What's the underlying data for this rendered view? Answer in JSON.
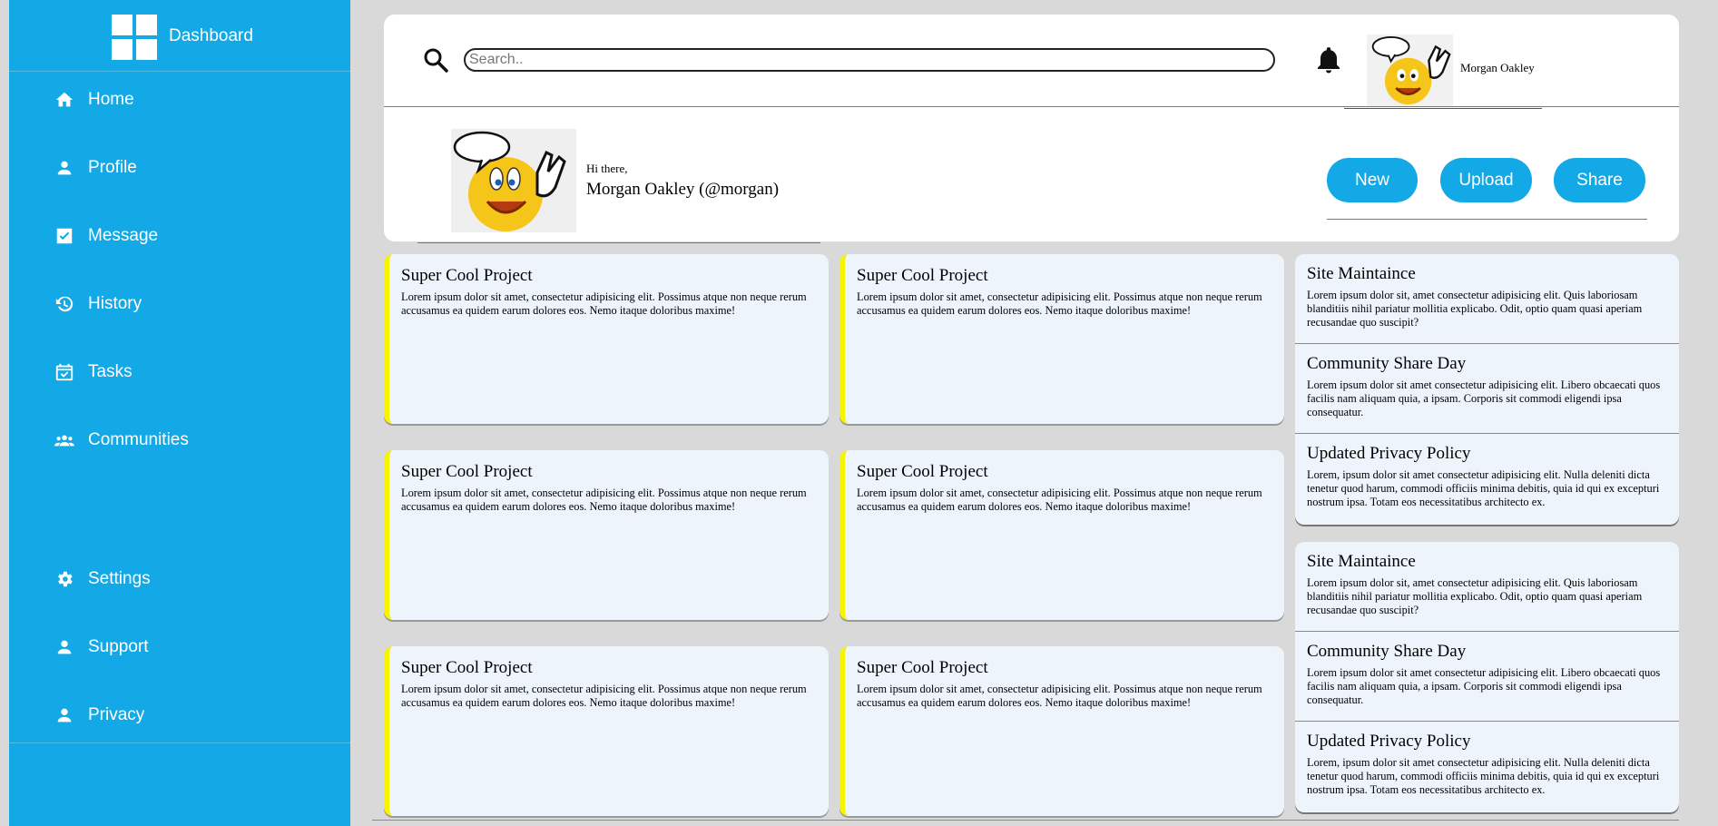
{
  "sidebar": {
    "title": "Dashboard",
    "items": [
      {
        "label": "Home",
        "icon": "home-icon"
      },
      {
        "label": "Profile",
        "icon": "person-icon"
      },
      {
        "label": "Message",
        "icon": "message-check-icon"
      },
      {
        "label": "History",
        "icon": "history-icon"
      },
      {
        "label": "Tasks",
        "icon": "calendar-check-icon"
      },
      {
        "label": "Communities",
        "icon": "group-icon"
      }
    ],
    "bottom_items": [
      {
        "label": "Settings",
        "icon": "gear-icon"
      },
      {
        "label": "Support",
        "icon": "person-icon"
      },
      {
        "label": "Privacy",
        "icon": "person-icon"
      }
    ]
  },
  "header": {
    "search_placeholder": "Search..",
    "username": "Morgan Oakley",
    "greeting": "Hi there,",
    "full_name": "Morgan Oakley (@morgan)",
    "buttons": [
      "New",
      "Upload",
      "Share"
    ]
  },
  "projects": [
    {
      "title": "Super Cool Project",
      "text": "Lorem ipsum dolor sit amet, consectetur adipisicing elit. Possimus atque non neque rerum accusamus ea quidem earum dolores eos. Nemo itaque doloribus maxime!"
    },
    {
      "title": "Super Cool Project",
      "text": "Lorem ipsum dolor sit amet, consectetur adipisicing elit. Possimus atque non neque rerum accusamus ea quidem earum dolores eos. Nemo itaque doloribus maxime!"
    },
    {
      "title": "Super Cool Project",
      "text": "Lorem ipsum dolor sit amet, consectetur adipisicing elit. Possimus atque non neque rerum accusamus ea quidem earum dolores eos. Nemo itaque doloribus maxime!"
    },
    {
      "title": "Super Cool Project",
      "text": "Lorem ipsum dolor sit amet, consectetur adipisicing elit. Possimus atque non neque rerum accusamus ea quidem earum dolores eos. Nemo itaque doloribus maxime!"
    },
    {
      "title": "Super Cool Project",
      "text": "Lorem ipsum dolor sit amet, consectetur adipisicing elit. Possimus atque non neque rerum accusamus ea quidem earum dolores eos. Nemo itaque doloribus maxime!"
    },
    {
      "title": "Super Cool Project",
      "text": "Lorem ipsum dolor sit amet, consectetur adipisicing elit. Possimus atque non neque rerum accusamus ea quidem earum dolores eos. Nemo itaque doloribus maxime!"
    }
  ],
  "announcements": [
    {
      "title": "Site Maintaince",
      "text": "Lorem ipsum dolor sit, amet consectetur adipisicing elit. Quis laboriosam blanditiis nihil pariatur mollitia explicabo. Odit, optio quam quasi aperiam recusandae quo suscipit?"
    },
    {
      "title": "Community Share Day",
      "text": "Lorem ipsum dolor sit amet consectetur adipisicing elit. Libero obcaecati quos facilis nam aliquam quia, a ipsam. Corporis sit commodi eligendi ipsa consequatur."
    },
    {
      "title": "Updated Privacy Policy",
      "text": "Lorem, ipsum dolor sit amet consectetur adipisicing elit. Nulla deleniti dicta tenetur quod harum, commodi officiis minima debitis, quia id qui ex excepturi nostrum ipsa. Totam eos necessitatibus architecto ex."
    },
    {
      "title": "Site Maintaince",
      "text": "Lorem ipsum dolor sit, amet consectetur adipisicing elit. Quis laboriosam blanditiis nihil pariatur mollitia explicabo. Odit, optio quam quasi aperiam recusandae quo suscipit?"
    },
    {
      "title": "Community Share Day",
      "text": "Lorem ipsum dolor sit amet consectetur adipisicing elit. Libero obcaecati quos facilis nam aliquam quia, a ipsam. Corporis sit commodi eligendi ipsa consequatur."
    },
    {
      "title": "Updated Privacy Policy",
      "text": "Lorem, ipsum dolor sit amet consectetur adipisicing elit. Nulla deleniti dicta tenetur quod harum, commodi officiis minima debitis, quia id qui ex excepturi nostrum ipsa. Totam eos necessitatibus architecto ex."
    }
  ],
  "colors": {
    "accent": "#13a8e6",
    "card_bg": "#edf4fb",
    "card_stripe": "#f5f500",
    "page_bg": "#d9d9d9"
  }
}
